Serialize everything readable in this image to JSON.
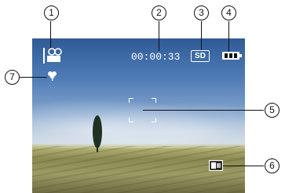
{
  "osd": {
    "timecode": "00:00:33",
    "storage_label": "SD",
    "battery_bars": 3
  },
  "callouts": [
    "1",
    "2",
    "3",
    "4",
    "5",
    "6",
    "7"
  ],
  "icons": {
    "mode": "movie-camera-icon",
    "macro": "macro-flower-icon",
    "storage": "sd-card-icon",
    "battery": "battery-icon",
    "focus": "focus-frame-icon",
    "stabilizer": "stabilizer-icon"
  },
  "colors": {
    "osd": "#ffffff"
  }
}
